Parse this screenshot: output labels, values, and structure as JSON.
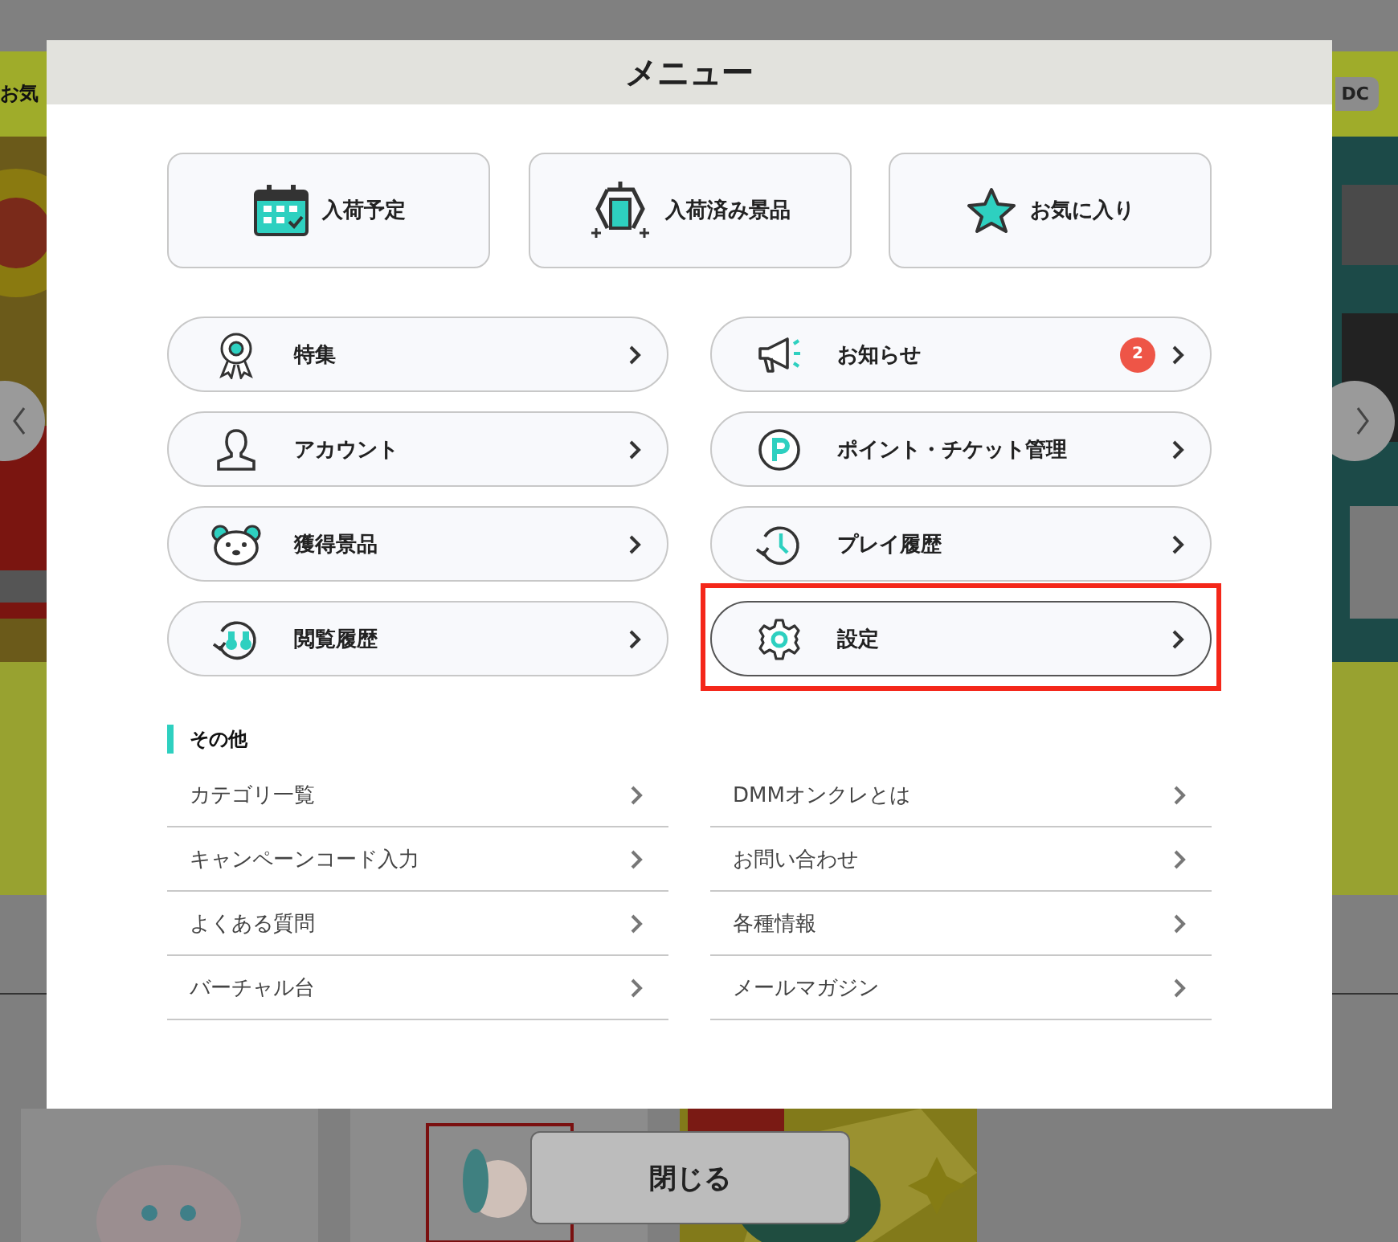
{
  "background": {
    "favorites_label": "お気",
    "points_badge": "DC"
  },
  "menu": {
    "title": "メニュー",
    "tiles": [
      {
        "kind": "calendar",
        "label": "入荷予定"
      },
      {
        "kind": "crane",
        "label": "入荷済み景品"
      },
      {
        "kind": "star",
        "label": "お気に入り"
      }
    ],
    "items": [
      {
        "kind": "medal",
        "label": "特集",
        "highlighted": false
      },
      {
        "kind": "megaphone",
        "label": "お知らせ",
        "badge": "2",
        "highlighted": false
      },
      {
        "kind": "person",
        "label": "アカウント",
        "highlighted": false
      },
      {
        "kind": "points",
        "label": "ポイント・チケット管理",
        "highlighted": false
      },
      {
        "kind": "bear",
        "label": "獲得景品",
        "highlighted": false
      },
      {
        "kind": "history",
        "label": "プレイ履歴",
        "highlighted": false
      },
      {
        "kind": "binoculars",
        "label": "閲覧履歴",
        "highlighted": false
      },
      {
        "kind": "gear",
        "label": "設定",
        "highlighted": true
      }
    ],
    "other": {
      "heading": "その他",
      "links": [
        "カテゴリ一覧",
        "DMMオンクレとは",
        "キャンペーンコード入力",
        "お問い合わせ",
        "よくある質問",
        "各種情報",
        "バーチャル台",
        "メールマガジン"
      ]
    }
  },
  "close_button": "閉じる"
}
